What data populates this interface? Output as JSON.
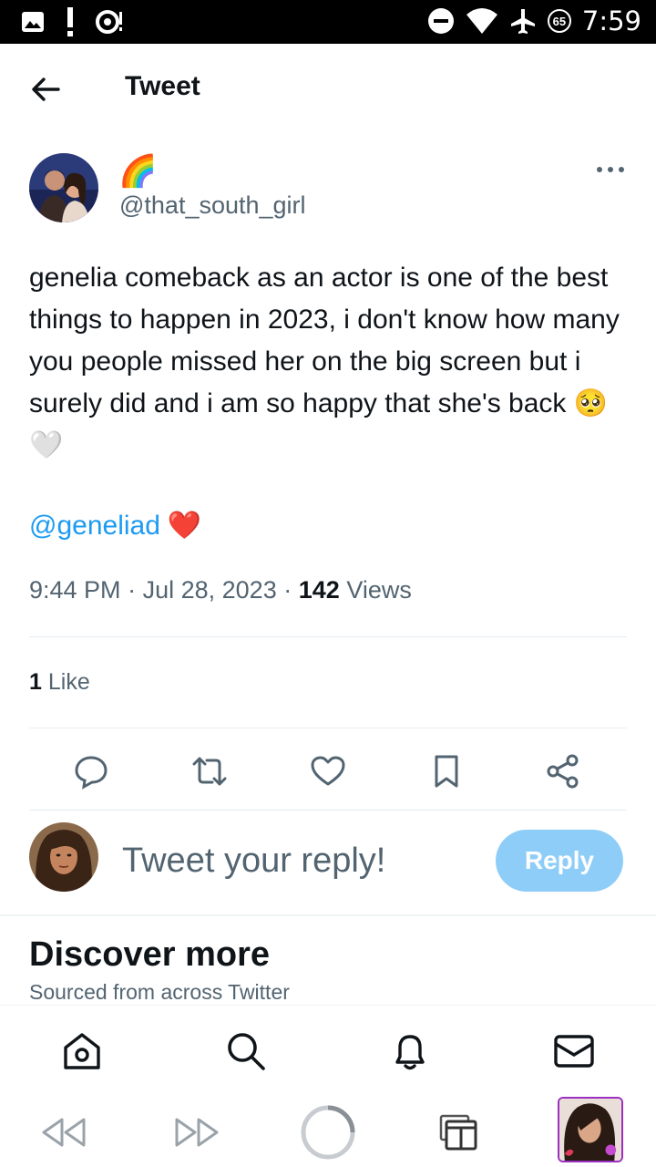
{
  "status_bar": {
    "time": "7:59",
    "badge": "65",
    "icons": [
      "image-icon",
      "alert-icon",
      "sync-icon",
      "dnd-icon",
      "wifi-icon",
      "airplane-icon",
      "data-saver-icon"
    ]
  },
  "header": {
    "title": "Tweet",
    "back_icon": "arrow-left-icon"
  },
  "tweet": {
    "display_name": "🌈",
    "handle": "@that_south_girl",
    "text": "genelia comeback as an actor is one of the best things to happen in 2023, i don't know how many you people missed her on the big screen but i surely did and i am so happy that she's back 🥺🤍",
    "mention": "@geneliad",
    "mention_emoji": "❤️",
    "time": "9:44 PM",
    "separator": "·",
    "date": "Jul 28, 2023",
    "views_count": "142",
    "views_label": "Views",
    "likes_count": "1",
    "likes_label": "Like"
  },
  "actions": [
    "reply-icon",
    "retweet-icon",
    "like-icon",
    "bookmark-icon",
    "share-icon"
  ],
  "reply_box": {
    "placeholder": "Tweet your reply!",
    "button_label": "Reply"
  },
  "discover": {
    "title": "Discover more",
    "subtitle": "Sourced from across Twitter"
  },
  "bottom_nav": [
    "home-icon",
    "search-icon",
    "notifications-icon",
    "messages-icon"
  ],
  "colors": {
    "accent": "#1d9bf0",
    "reply_button": "#8ecdf8",
    "secondary_text": "#536471",
    "primary_text": "#0f1419"
  }
}
